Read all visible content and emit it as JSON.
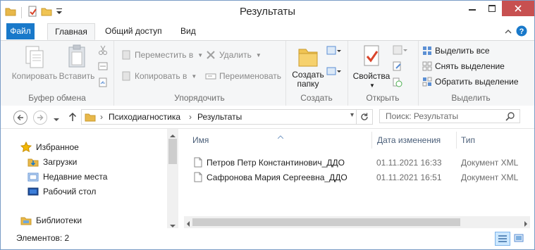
{
  "window": {
    "title": "Результаты"
  },
  "tabs": {
    "file": "Файл",
    "home": "Главная",
    "share": "Общий доступ",
    "view": "Вид"
  },
  "ribbon": {
    "clipboard": {
      "copy": "Копировать",
      "paste": "Вставить",
      "group": "Буфер обмена"
    },
    "organize": {
      "move_to": "Переместить в",
      "copy_to": "Копировать в",
      "delete": "Удалить",
      "rename": "Переименовать",
      "group": "Упорядочить"
    },
    "new": {
      "new_folder_line1": "Создать",
      "new_folder_line2": "папку",
      "group": "Создать"
    },
    "open": {
      "properties": "Свойства",
      "group": "Открыть"
    },
    "select": {
      "select_all": "Выделить все",
      "select_none": "Снять выделение",
      "invert": "Обратить выделение",
      "group": "Выделить"
    }
  },
  "address": {
    "crumbs": [
      "Психодиагностика",
      "Результаты"
    ],
    "search_placeholder": "Поиск: Результаты"
  },
  "nav": {
    "favorites": "Избранное",
    "downloads": "Загрузки",
    "recent": "Недавние места",
    "desktop": "Рабочий стол",
    "libraries": "Библиотеки"
  },
  "columns": {
    "name": "Имя",
    "date": "Дата изменения",
    "type": "Тип"
  },
  "files": [
    {
      "name": "Петров Петр Константинович_ДДО",
      "date": "01.11.2021 16:33",
      "type": "Документ XML"
    },
    {
      "name": "Сафронова Мария Сергеевна_ДДО",
      "date": "01.11.2021 16:51",
      "type": "Документ XML"
    }
  ],
  "status": {
    "items": "Элементов: 2"
  },
  "colors": {
    "accent": "#1979ca",
    "close": "#c75050",
    "ribbon_bg": "#f5f6f7"
  }
}
